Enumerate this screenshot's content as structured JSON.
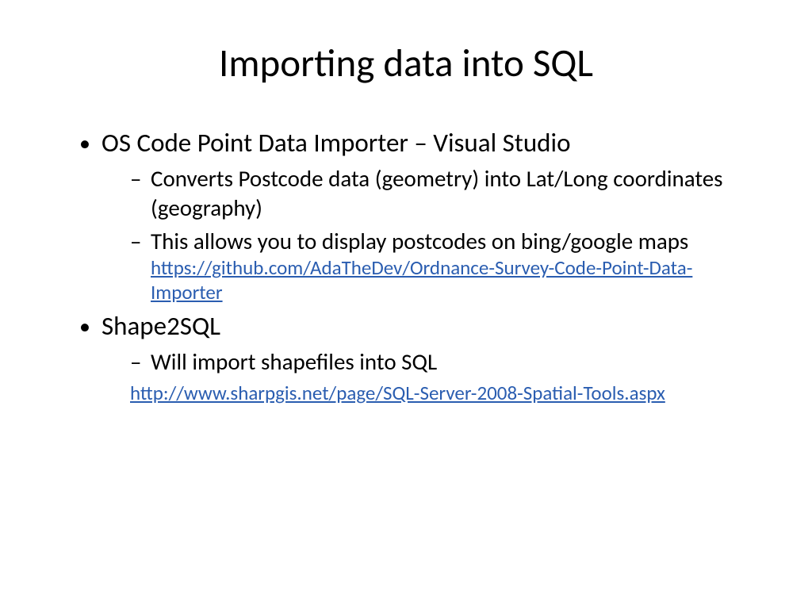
{
  "title": "Importing data into SQL",
  "items": [
    {
      "label": "OS Code Point Data Importer – Visual Studio",
      "children": [
        {
          "label": "Converts Postcode data (geometry) into Lat/Long coordinates (geography)"
        },
        {
          "label": "This allows you to display postcodes on bing/google maps",
          "link": "https://github.com/AdaTheDev/Ordnance-Survey-Code-Point-Data-Importer"
        }
      ]
    },
    {
      "label": "Shape2SQL",
      "children": [
        {
          "label": "Will import shapefiles into SQL",
          "link_below": "http://www.sharpgis.net/page/SQL-Server-2008-Spatial-Tools.aspx"
        }
      ]
    }
  ]
}
